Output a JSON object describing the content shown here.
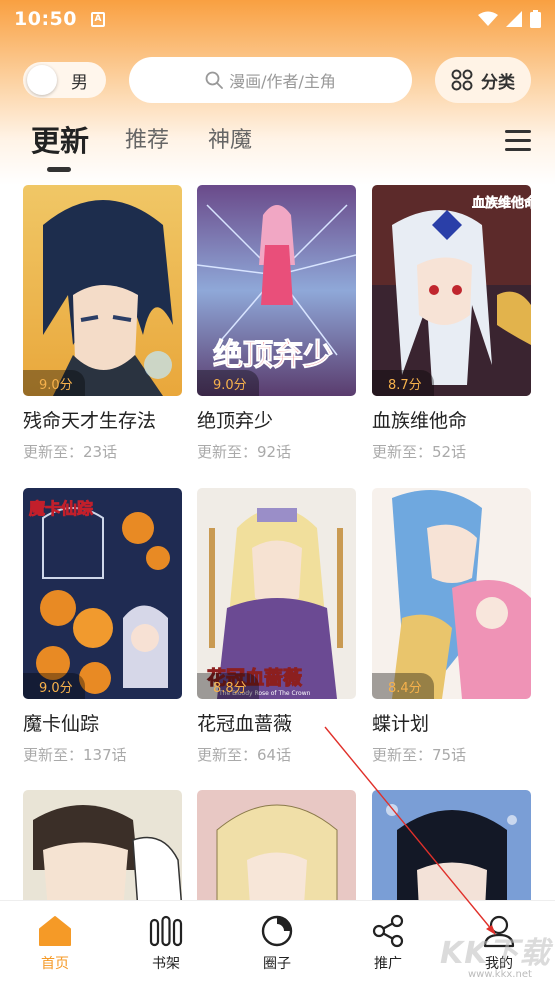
{
  "status_bar": {
    "time": "10:50",
    "indicator": "A"
  },
  "header": {
    "gender_label": "男",
    "search_placeholder": "漫画/作者/主角",
    "category_label": "分类"
  },
  "tabs": [
    {
      "label": "更新",
      "active": true
    },
    {
      "label": "推荐",
      "active": false
    },
    {
      "label": "神魔",
      "active": false
    }
  ],
  "comics": [
    {
      "title": "残命天才生存法",
      "rating": "9.0分",
      "update": "更新至：23话"
    },
    {
      "title": "绝顶弃少",
      "rating": "9.0分",
      "update": "更新至：92话",
      "cover_text": "绝顶弃少"
    },
    {
      "title": "血族维他命",
      "rating": "8.7分",
      "update": "更新至：52话",
      "cover_text": "血族维他命"
    },
    {
      "title": "魔卡仙踪",
      "rating": "9.0分",
      "update": "更新至：137话",
      "cover_text": "魔卡仙踪"
    },
    {
      "title": "花冠血蔷薇",
      "rating": "8.8分",
      "update": "更新至：64话",
      "cover_text": "花冠血蔷薇",
      "cover_subtext": "The Bloody Rose of The Crown"
    },
    {
      "title": "蝶计划",
      "rating": "8.4分",
      "update": "更新至：75话"
    },
    {
      "title": "",
      "rating": "",
      "update": ""
    },
    {
      "title": "",
      "rating": "",
      "update": ""
    },
    {
      "title": "",
      "rating": "",
      "update": ""
    }
  ],
  "bottom_nav": [
    {
      "label": "首页",
      "icon": "home-icon",
      "active": true
    },
    {
      "label": "书架",
      "icon": "bookshelf-icon",
      "active": false
    },
    {
      "label": "圈子",
      "icon": "circle-icon",
      "active": false
    },
    {
      "label": "推广",
      "icon": "share-icon",
      "active": false
    },
    {
      "label": "我的",
      "icon": "user-icon",
      "active": false
    }
  ],
  "watermark": {
    "text": "KK下载",
    "url": "www.kkx.net"
  },
  "colors": {
    "accent": "#f59a27",
    "header_top": "#f9a041",
    "rating_text": "#f6b14c"
  }
}
